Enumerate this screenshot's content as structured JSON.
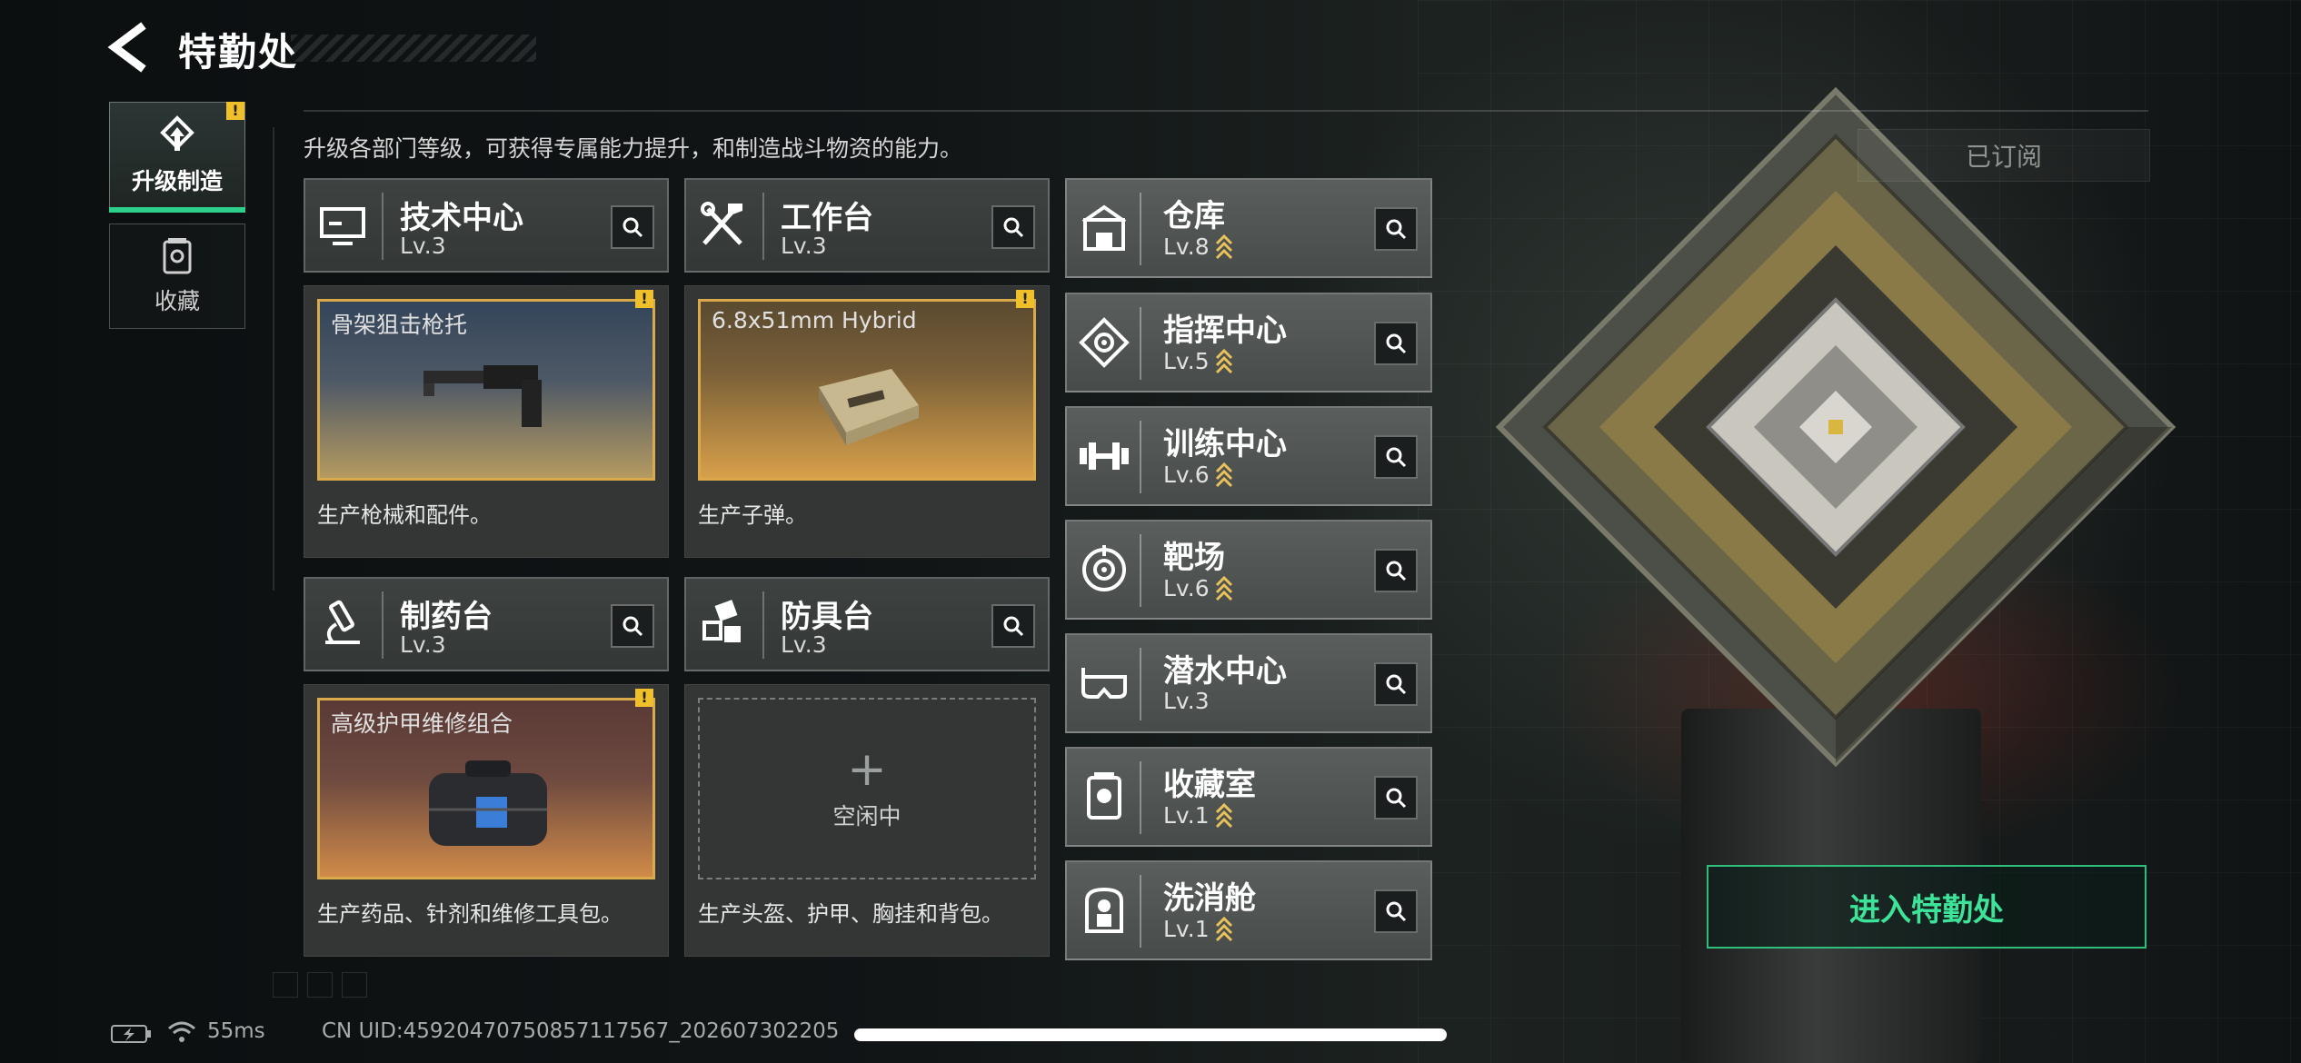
{
  "header": {
    "title": "特勤处",
    "subtitle": "升级各部门等级，可获得专属能力提升，和制造战斗物资的能力。",
    "subscribed_label": "已订阅"
  },
  "sidebar": {
    "tabs": [
      {
        "label": "升级制造",
        "icon": "upgrade-icon",
        "active": true,
        "alert": "!"
      },
      {
        "label": "收藏",
        "icon": "collection-icon",
        "active": false
      }
    ]
  },
  "departments": [
    {
      "name": "技术中心",
      "level": "Lv.3",
      "icon": "tech-center-icon",
      "product": {
        "name": "骨架狙击枪托",
        "alert": "!"
      },
      "description": "生产枪械和配件。"
    },
    {
      "name": "工作台",
      "level": "Lv.3",
      "icon": "workbench-icon",
      "product": {
        "name": "6.8x51mm Hybrid",
        "alert": "!"
      },
      "description": "生产子弹。"
    },
    {
      "name": "制药台",
      "level": "Lv.3",
      "icon": "pharmacy-icon",
      "product": {
        "name": "高级护甲维修组合",
        "alert": "!"
      },
      "description": "生产药品、针剂和维修工具包。"
    },
    {
      "name": "防具台",
      "level": "Lv.3",
      "icon": "armor-bench-icon",
      "idle": {
        "plus": "+",
        "label": "空闲中"
      },
      "description": "生产头盔、护甲、胸挂和背包。"
    }
  ],
  "facilities": [
    {
      "name": "仓库",
      "level": "Lv.8",
      "upgradable": true,
      "icon": "warehouse-icon"
    },
    {
      "name": "指挥中心",
      "level": "Lv.5",
      "upgradable": true,
      "icon": "command-center-icon"
    },
    {
      "name": "训练中心",
      "level": "Lv.6",
      "upgradable": true,
      "icon": "training-center-icon"
    },
    {
      "name": "靶场",
      "level": "Lv.6",
      "upgradable": true,
      "icon": "shooting-range-icon"
    },
    {
      "name": "潜水中心",
      "level": "Lv.3",
      "upgradable": false,
      "icon": "diving-center-icon"
    },
    {
      "name": "收藏室",
      "level": "Lv.1",
      "upgradable": true,
      "icon": "collection-room-icon"
    },
    {
      "name": "洗消舱",
      "level": "Lv.1",
      "upgradable": true,
      "icon": "decontamination-icon"
    }
  ],
  "enter_button": "进入特勤处",
  "status_bar": {
    "ping": "55ms",
    "uid": "CN UID:4592047075085711756​7_202607302205"
  },
  "colors": {
    "accent_green": "#2cd08a",
    "warning_yellow": "#f0c02a",
    "product_border": "#d9a94a",
    "upgrade_chevron": "#e8c25a"
  }
}
